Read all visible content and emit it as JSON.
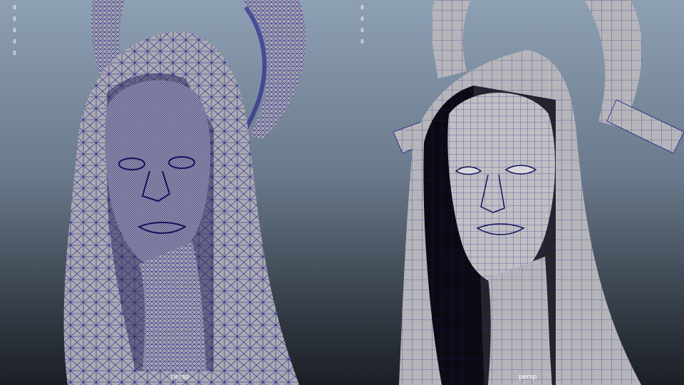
{
  "viewports": [
    {
      "name": "left-viewport",
      "hud_values": [
        "0",
        "0",
        "0",
        "0",
        "0"
      ],
      "camera_label": "persp",
      "mesh_density": "high",
      "wire_color": "#1c1a8c",
      "surface_color": "#a8a8ae"
    },
    {
      "name": "right-viewport",
      "hud_values": [
        "0",
        "0",
        "0",
        "0"
      ],
      "camera_label": "persp",
      "mesh_density": "low",
      "wire_color": "#1c1a8c",
      "surface_color": "#b4b4b8"
    }
  ]
}
